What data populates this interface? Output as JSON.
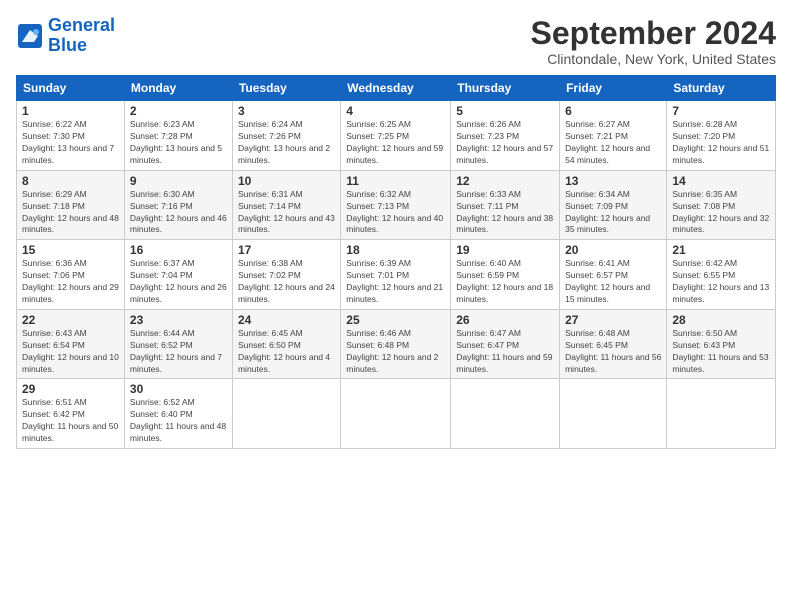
{
  "header": {
    "logo_line1": "General",
    "logo_line2": "Blue",
    "month": "September 2024",
    "location": "Clintondale, New York, United States"
  },
  "days_of_week": [
    "Sunday",
    "Monday",
    "Tuesday",
    "Wednesday",
    "Thursday",
    "Friday",
    "Saturday"
  ],
  "weeks": [
    [
      {
        "day": "1",
        "sunrise": "6:22 AM",
        "sunset": "7:30 PM",
        "daylight": "13 hours and 7 minutes."
      },
      {
        "day": "2",
        "sunrise": "6:23 AM",
        "sunset": "7:28 PM",
        "daylight": "13 hours and 5 minutes."
      },
      {
        "day": "3",
        "sunrise": "6:24 AM",
        "sunset": "7:26 PM",
        "daylight": "13 hours and 2 minutes."
      },
      {
        "day": "4",
        "sunrise": "6:25 AM",
        "sunset": "7:25 PM",
        "daylight": "12 hours and 59 minutes."
      },
      {
        "day": "5",
        "sunrise": "6:26 AM",
        "sunset": "7:23 PM",
        "daylight": "12 hours and 57 minutes."
      },
      {
        "day": "6",
        "sunrise": "6:27 AM",
        "sunset": "7:21 PM",
        "daylight": "12 hours and 54 minutes."
      },
      {
        "day": "7",
        "sunrise": "6:28 AM",
        "sunset": "7:20 PM",
        "daylight": "12 hours and 51 minutes."
      }
    ],
    [
      {
        "day": "8",
        "sunrise": "6:29 AM",
        "sunset": "7:18 PM",
        "daylight": "12 hours and 48 minutes."
      },
      {
        "day": "9",
        "sunrise": "6:30 AM",
        "sunset": "7:16 PM",
        "daylight": "12 hours and 46 minutes."
      },
      {
        "day": "10",
        "sunrise": "6:31 AM",
        "sunset": "7:14 PM",
        "daylight": "12 hours and 43 minutes."
      },
      {
        "day": "11",
        "sunrise": "6:32 AM",
        "sunset": "7:13 PM",
        "daylight": "12 hours and 40 minutes."
      },
      {
        "day": "12",
        "sunrise": "6:33 AM",
        "sunset": "7:11 PM",
        "daylight": "12 hours and 38 minutes."
      },
      {
        "day": "13",
        "sunrise": "6:34 AM",
        "sunset": "7:09 PM",
        "daylight": "12 hours and 35 minutes."
      },
      {
        "day": "14",
        "sunrise": "6:35 AM",
        "sunset": "7:08 PM",
        "daylight": "12 hours and 32 minutes."
      }
    ],
    [
      {
        "day": "15",
        "sunrise": "6:36 AM",
        "sunset": "7:06 PM",
        "daylight": "12 hours and 29 minutes."
      },
      {
        "day": "16",
        "sunrise": "6:37 AM",
        "sunset": "7:04 PM",
        "daylight": "12 hours and 26 minutes."
      },
      {
        "day": "17",
        "sunrise": "6:38 AM",
        "sunset": "7:02 PM",
        "daylight": "12 hours and 24 minutes."
      },
      {
        "day": "18",
        "sunrise": "6:39 AM",
        "sunset": "7:01 PM",
        "daylight": "12 hours and 21 minutes."
      },
      {
        "day": "19",
        "sunrise": "6:40 AM",
        "sunset": "6:59 PM",
        "daylight": "12 hours and 18 minutes."
      },
      {
        "day": "20",
        "sunrise": "6:41 AM",
        "sunset": "6:57 PM",
        "daylight": "12 hours and 15 minutes."
      },
      {
        "day": "21",
        "sunrise": "6:42 AM",
        "sunset": "6:55 PM",
        "daylight": "12 hours and 13 minutes."
      }
    ],
    [
      {
        "day": "22",
        "sunrise": "6:43 AM",
        "sunset": "6:54 PM",
        "daylight": "12 hours and 10 minutes."
      },
      {
        "day": "23",
        "sunrise": "6:44 AM",
        "sunset": "6:52 PM",
        "daylight": "12 hours and 7 minutes."
      },
      {
        "day": "24",
        "sunrise": "6:45 AM",
        "sunset": "6:50 PM",
        "daylight": "12 hours and 4 minutes."
      },
      {
        "day": "25",
        "sunrise": "6:46 AM",
        "sunset": "6:48 PM",
        "daylight": "12 hours and 2 minutes."
      },
      {
        "day": "26",
        "sunrise": "6:47 AM",
        "sunset": "6:47 PM",
        "daylight": "11 hours and 59 minutes."
      },
      {
        "day": "27",
        "sunrise": "6:48 AM",
        "sunset": "6:45 PM",
        "daylight": "11 hours and 56 minutes."
      },
      {
        "day": "28",
        "sunrise": "6:50 AM",
        "sunset": "6:43 PM",
        "daylight": "11 hours and 53 minutes."
      }
    ],
    [
      {
        "day": "29",
        "sunrise": "6:51 AM",
        "sunset": "6:42 PM",
        "daylight": "11 hours and 50 minutes."
      },
      {
        "day": "30",
        "sunrise": "6:52 AM",
        "sunset": "6:40 PM",
        "daylight": "11 hours and 48 minutes."
      },
      null,
      null,
      null,
      null,
      null
    ]
  ]
}
